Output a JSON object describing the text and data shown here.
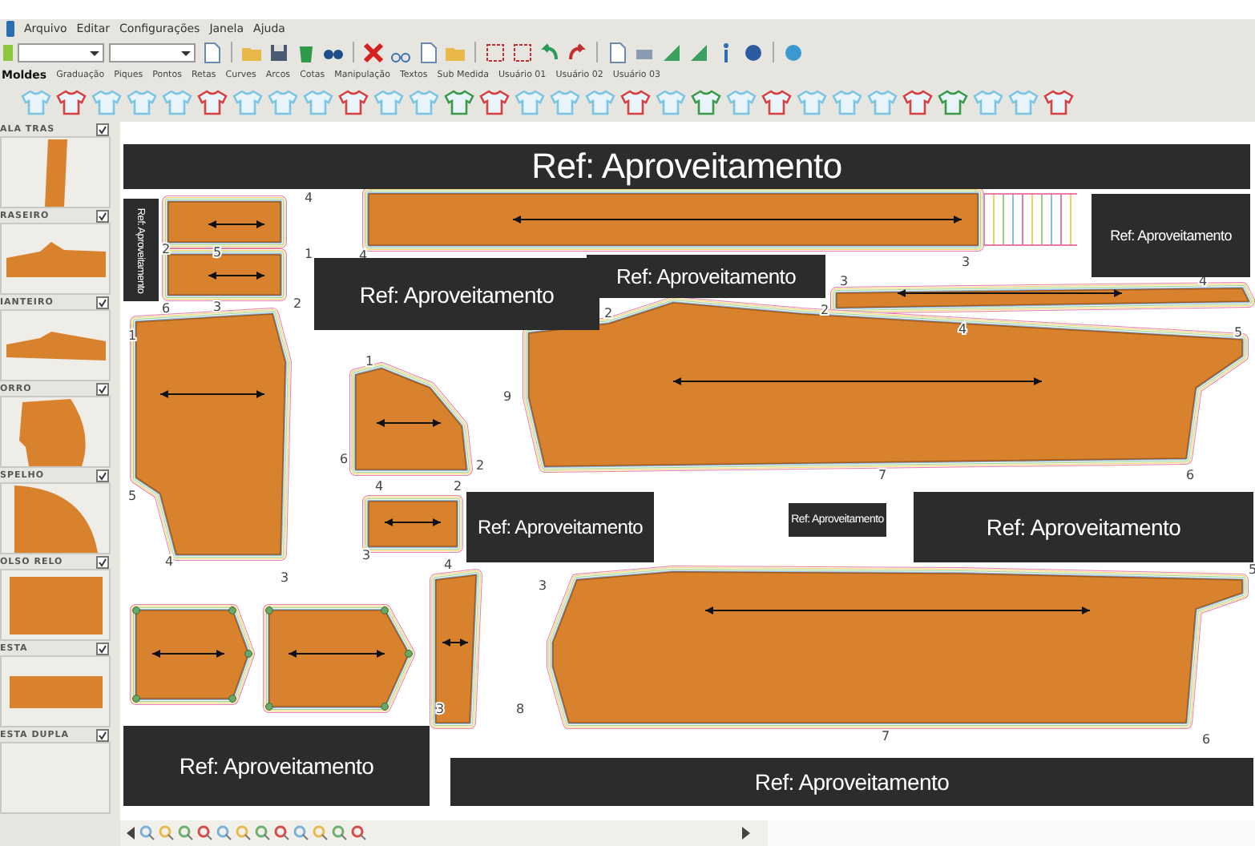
{
  "menu": [
    "Arquivo",
    "Editar",
    "Configurações",
    "Janela",
    "Ajuda"
  ],
  "tabs": [
    {
      "label": "Moldes",
      "selected": true
    },
    {
      "label": "Graduação",
      "selected": false
    },
    {
      "label": "Piques",
      "selected": false
    },
    {
      "label": "Pontos",
      "selected": false
    },
    {
      "label": "Retas",
      "selected": false
    },
    {
      "label": "Curves",
      "selected": false
    },
    {
      "label": "Arcos",
      "selected": false
    },
    {
      "label": "Cotas",
      "selected": false
    },
    {
      "label": "Manipulação",
      "selected": false
    },
    {
      "label": "Textos",
      "selected": false
    },
    {
      "label": "Sub Medida",
      "selected": false
    },
    {
      "label": "Usuário 01",
      "selected": false
    },
    {
      "label": "Usuário 02",
      "selected": false
    },
    {
      "label": "Usuário 03",
      "selected": false
    }
  ],
  "sidebar": [
    {
      "label": "ALA TRAS",
      "checked": true
    },
    {
      "label": "RASEIRO",
      "checked": true
    },
    {
      "label": "IANTEIRO",
      "checked": true
    },
    {
      "label": "ORRO",
      "checked": true
    },
    {
      "label": "SPELHO",
      "checked": true
    },
    {
      "label": "OLSO RELO",
      "checked": true
    },
    {
      "label": "ESTA",
      "checked": true
    },
    {
      "label": "ESTA DUPLA",
      "checked": true
    }
  ],
  "banners": [
    "Ref: Aproveitamento",
    "Ref: Aproveitamento",
    "Ref: Aproveitamento",
    "Ref: Aproveitamento",
    "Ref: Aproveitamento",
    "Ref: Aproveitamento",
    "Ref: Aproveitamento",
    "Ref: Aproveitamento",
    "Ref: Aproveitamento",
    "Ref: Aproveitamento"
  ],
  "pieces": [
    {
      "points": [
        "4",
        "5",
        "2"
      ]
    },
    {
      "points": [
        "1",
        "3",
        "6"
      ]
    },
    {
      "points": [
        "4",
        "3"
      ]
    },
    {
      "points": [
        "3",
        "2",
        "4"
      ]
    },
    {
      "points": [
        "1",
        "2",
        "5",
        "4",
        "3"
      ]
    },
    {
      "points": [
        "1",
        "6",
        "2"
      ]
    },
    {
      "points": [
        "4",
        "2",
        "3"
      ]
    },
    {
      "points": [
        "2",
        "4",
        "5",
        "9",
        "7",
        "6"
      ]
    },
    {
      "kind": "pocket"
    },
    {
      "kind": "pocket"
    },
    {
      "points": [
        "4",
        "3"
      ]
    },
    {
      "points": [
        "3",
        "5",
        "8",
        "7",
        "6"
      ]
    }
  ]
}
